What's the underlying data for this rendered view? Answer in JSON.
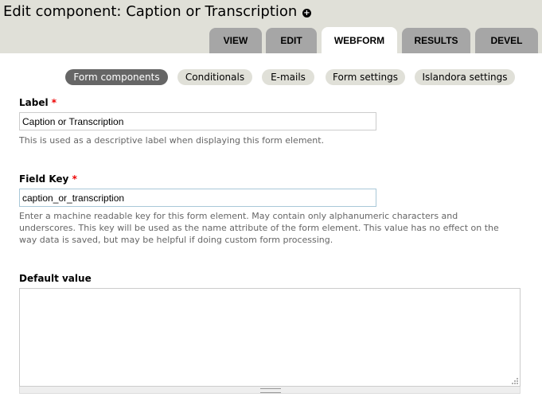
{
  "page": {
    "title": "Edit component: Caption or Transcription"
  },
  "primary_tabs": [
    {
      "label": "VIEW",
      "active": false
    },
    {
      "label": "EDIT",
      "active": false
    },
    {
      "label": "WEBFORM",
      "active": true
    },
    {
      "label": "RESULTS",
      "active": false
    },
    {
      "label": "DEVEL",
      "active": false
    }
  ],
  "secondary_tabs": [
    {
      "label": "Form components",
      "active": true
    },
    {
      "label": "Conditionals",
      "active": false
    },
    {
      "label": "E-mails",
      "active": false
    },
    {
      "label": "Form settings",
      "active": false
    },
    {
      "label": "Islandora settings",
      "active": false
    }
  ],
  "form": {
    "label_field": {
      "label": "Label",
      "required_marker": "*",
      "value": "Caption or Transcription",
      "description": "This is used as a descriptive label when displaying this form element."
    },
    "field_key": {
      "label": "Field Key",
      "required_marker": "*",
      "value": "caption_or_transcription",
      "description": "Enter a machine readable key for this form element. May contain only alphanumeric characters and underscores. This key will be used as the name attribute of the form element. This value has no effect on the way data is saved, but may be helpful if doing custom form processing."
    },
    "default_value": {
      "label": "Default value",
      "value": ""
    }
  },
  "colors": {
    "header_bg": "#e0e0d8",
    "tab_inactive": "#a6a6a6",
    "secondary_active": "#666666",
    "required": "#ee0000"
  }
}
